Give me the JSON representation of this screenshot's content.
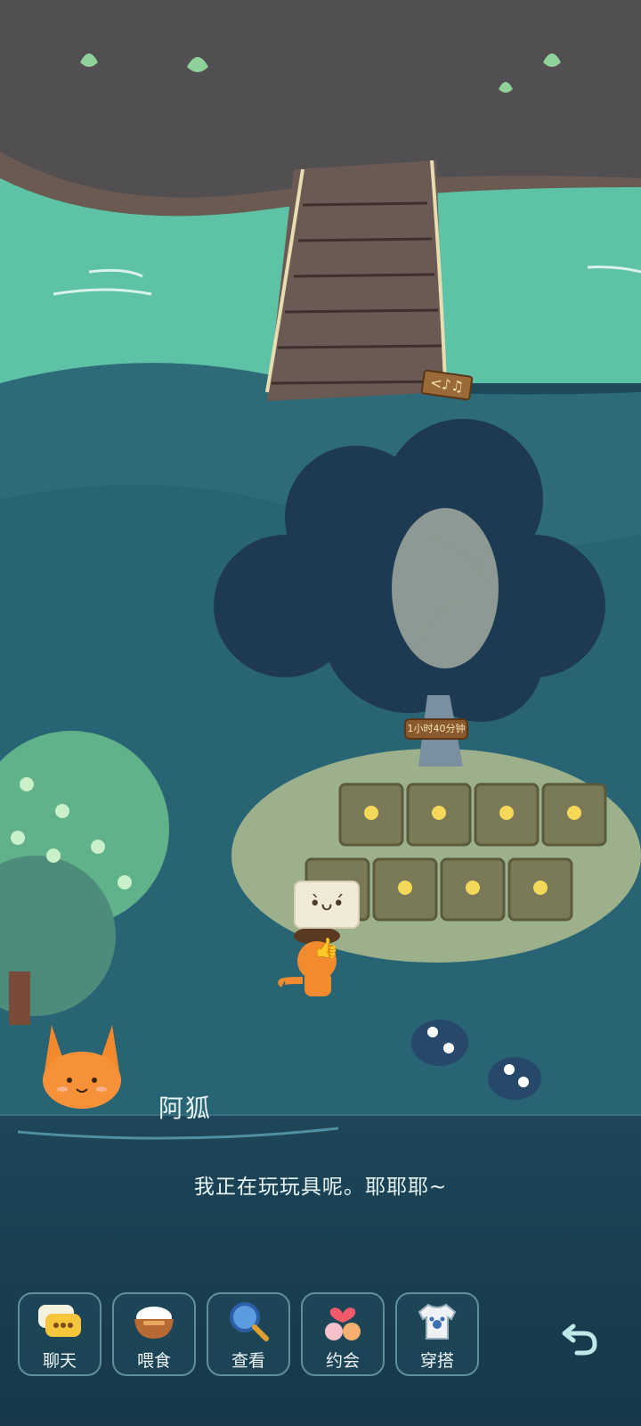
{
  "character": {
    "name": "阿狐",
    "dialogue": "我正在玩玩具呢。耶耶耶~"
  },
  "scene": {
    "timer_sign": "1小时40分钟",
    "music_sign": "<♪♫",
    "speech_bubble": "•̀ᴗ•́ 👍"
  },
  "actions": [
    {
      "label": "聊天",
      "icon": "chat-bubble-icon"
    },
    {
      "label": "喂食",
      "icon": "rice-bowl-icon"
    },
    {
      "label": "查看",
      "icon": "magnifier-icon"
    },
    {
      "label": "约会",
      "icon": "date-heart-icon"
    },
    {
      "label": "穿搭",
      "icon": "shirt-icon"
    }
  ],
  "back_icon": "undo-arrow-icon",
  "colors": {
    "water": "#5cc0a8",
    "deep": "#1f4a5a",
    "ground": "#524f52",
    "accent": "#f5a03a"
  }
}
